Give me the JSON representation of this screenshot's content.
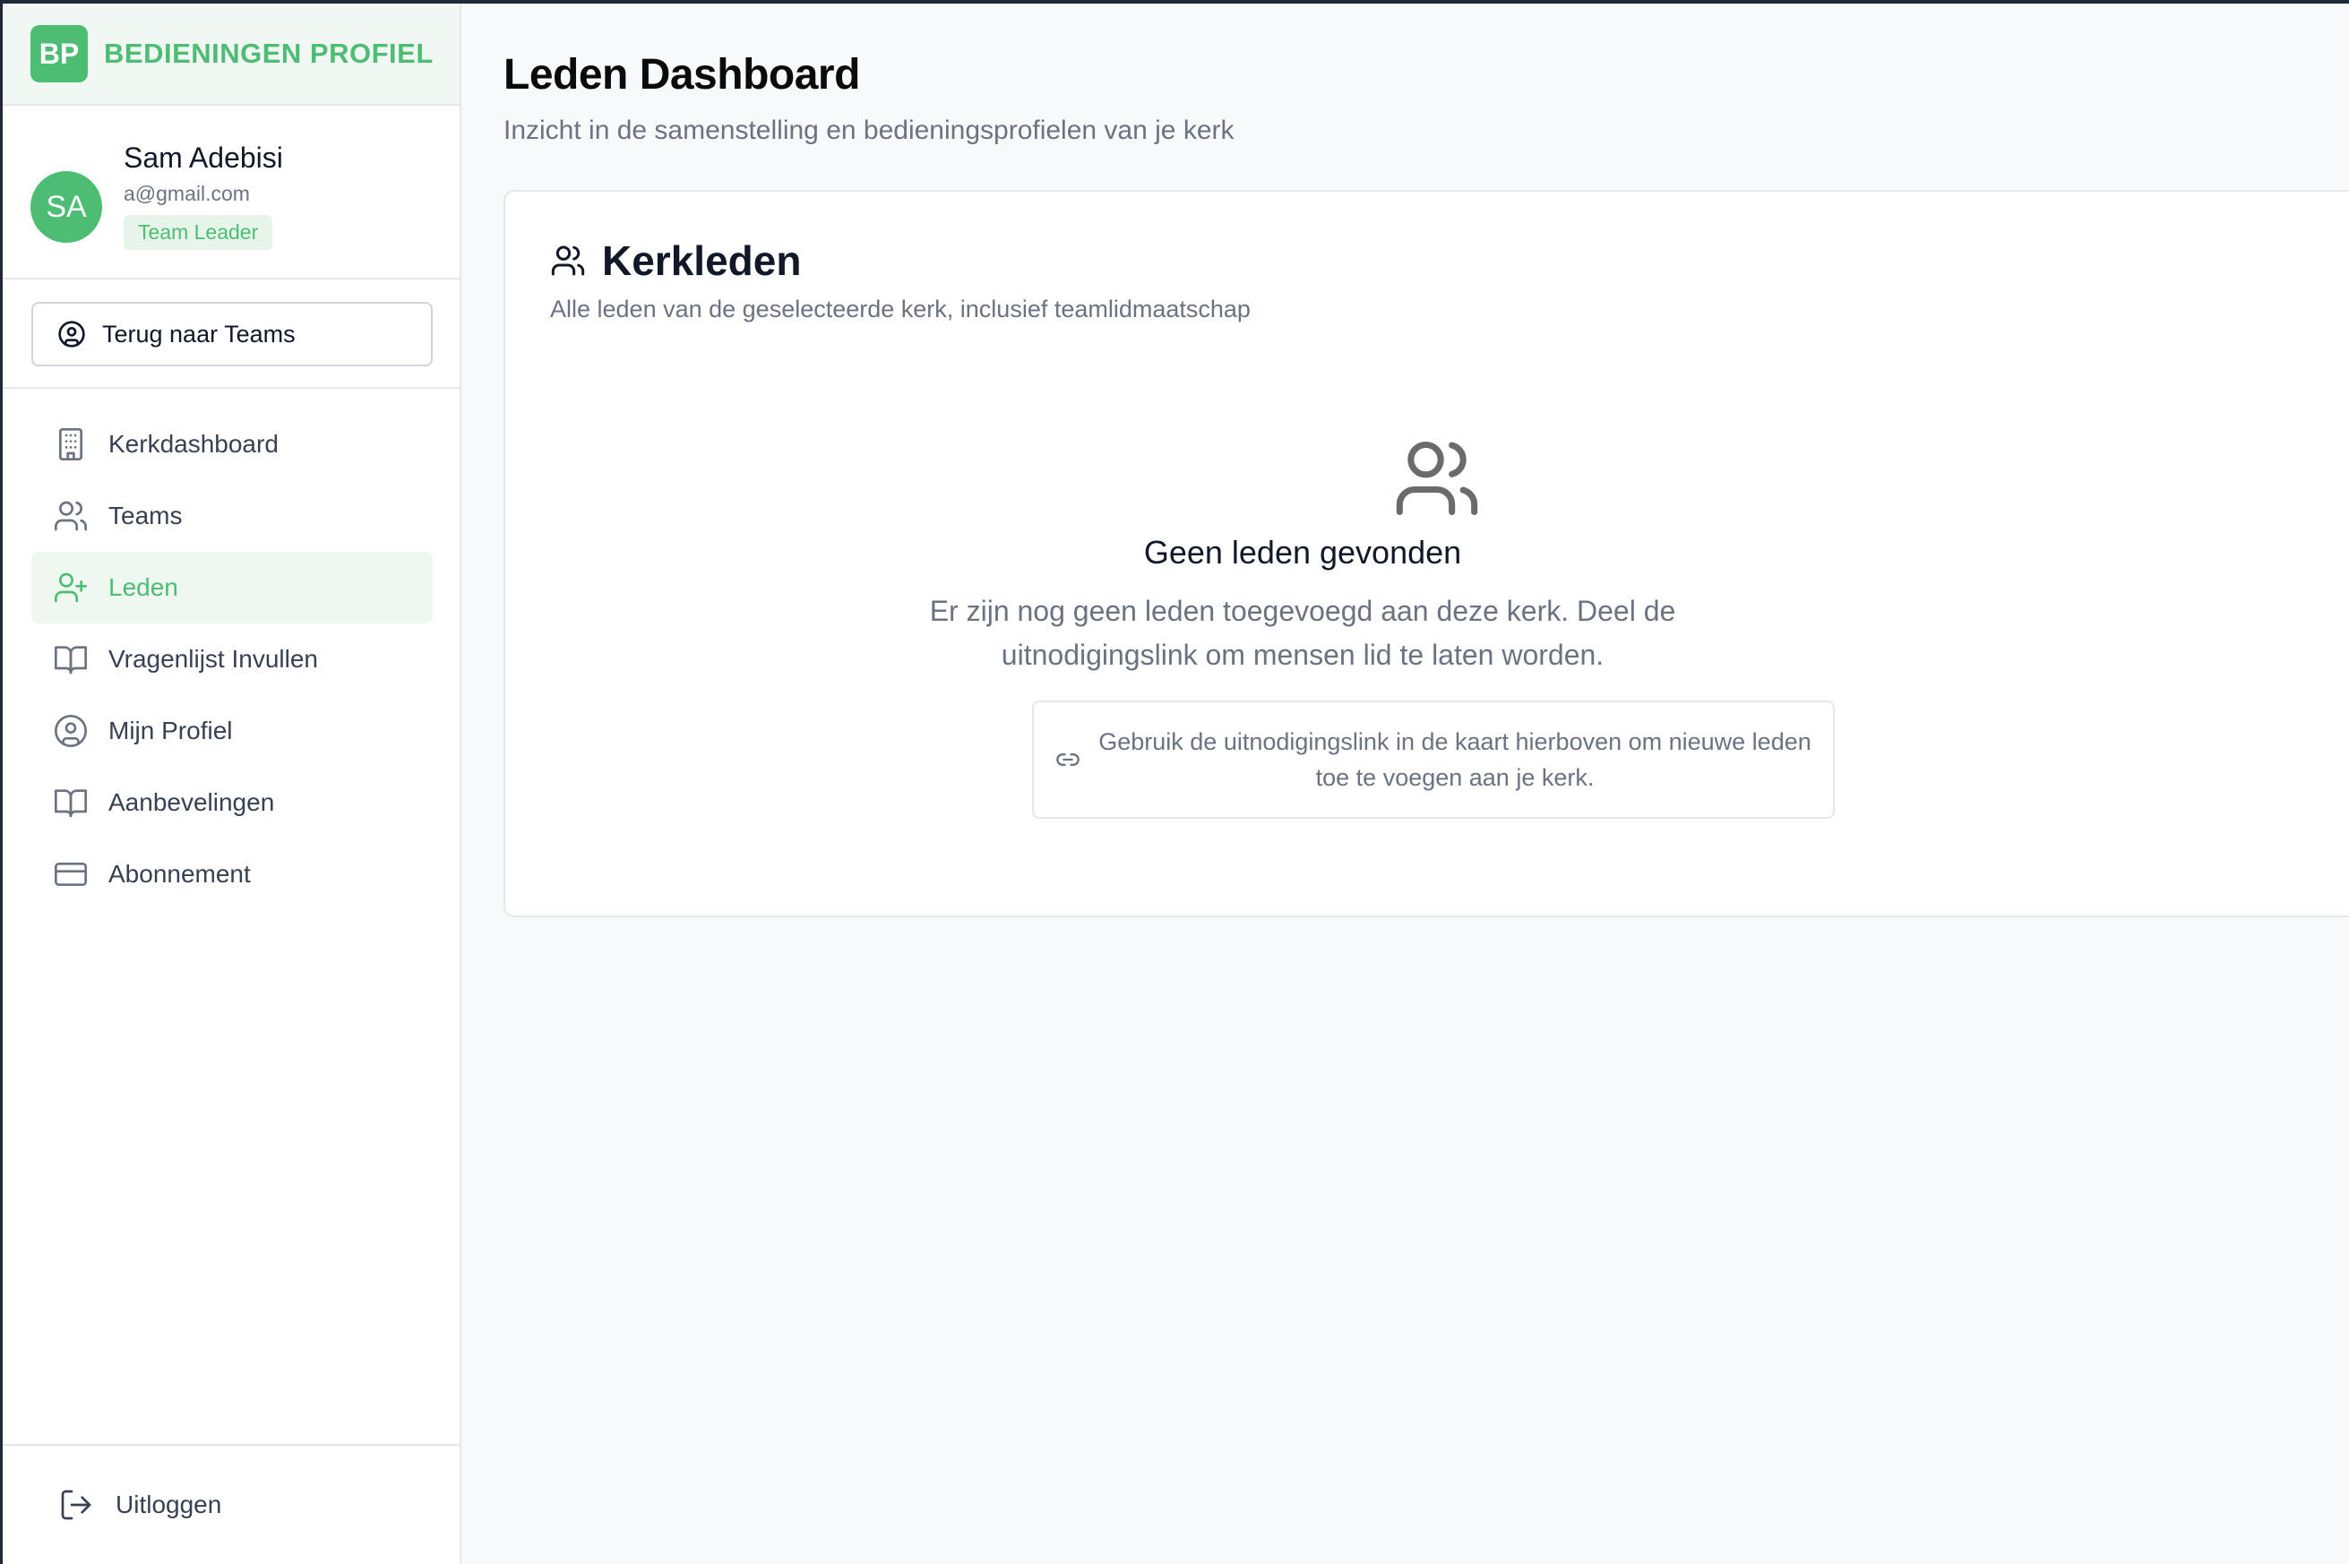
{
  "brand": {
    "logo": "BP",
    "name": "BEDIENINGEN PROFIEL"
  },
  "user": {
    "initials": "SA",
    "name": "Sam Adebisi",
    "email": "a@gmail.com",
    "role": "Team Leader"
  },
  "back_button": {
    "label": "Terug naar Teams",
    "icon": "user-circle-icon"
  },
  "nav": {
    "items": [
      {
        "label": "Kerkdashboard",
        "icon": "building-icon",
        "active": false
      },
      {
        "label": "Teams",
        "icon": "users-icon",
        "active": false
      },
      {
        "label": "Leden",
        "icon": "user-plus-icon",
        "active": true
      },
      {
        "label": "Vragenlijst Invullen",
        "icon": "book-icon",
        "active": false
      },
      {
        "label": "Mijn Profiel",
        "icon": "user-circle-icon",
        "active": false
      },
      {
        "label": "Aanbevelingen",
        "icon": "book-icon",
        "active": false
      },
      {
        "label": "Abonnement",
        "icon": "credit-card-icon",
        "active": false
      }
    ]
  },
  "logout": {
    "label": "Uitloggen",
    "icon": "logout-icon"
  },
  "page": {
    "title": "Leden Dashboard",
    "subtitle": "Inzicht in de samenstelling en bedieningsprofielen van je kerk"
  },
  "members_card": {
    "title": "Kerkleden",
    "subtitle": "Alle leden van de geselecteerde kerk, inclusief teamlidmaatschap",
    "empty_title": "Geen leden gevonden",
    "empty_description": "Er zijn nog geen leden toegevoegd aan deze kerk. Deel de uitnodigingslink om mensen lid te laten worden.",
    "hint": "Gebruik de uitnodigingslink in de kaart hierboven om nieuwe leden toe te voegen aan je kerk."
  },
  "colors": {
    "accent": "#4dbd74",
    "accent_soft": "#eef7f0",
    "text_muted": "#6b7280",
    "border": "#e5e7eb"
  }
}
